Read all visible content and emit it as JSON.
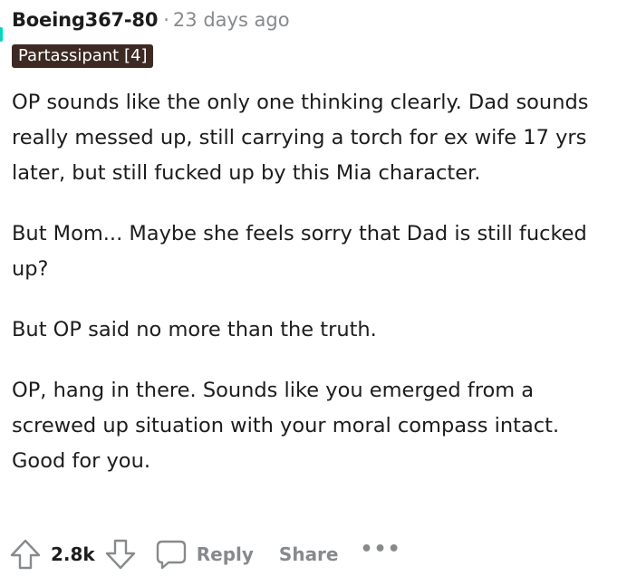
{
  "comment": {
    "author": "Boeing367-80",
    "separator": "·",
    "timestamp": "23 days ago",
    "flair": "Partassipant [4]",
    "paragraphs": [
      "OP sounds like the only one thinking clearly. Dad sounds really messed up, still carrying a torch for ex wife 17 yrs later, but still fucked up by this Mia character.",
      "But Mom... Maybe she feels sorry that Dad is still fucked up?",
      "But OP said no more than the truth.",
      "OP, hang in there. Sounds like you emerged from a screwed up situation with your moral compass intact. Good for you."
    ]
  },
  "actions": {
    "upvote_icon": "upvote-arrow-icon",
    "score": "2.8k",
    "downvote_icon": "downvote-arrow-icon",
    "reply_icon": "speech-bubble-icon",
    "reply_label": "Reply",
    "share_label": "Share",
    "more_label": "•••"
  },
  "colors": {
    "text": "#1c1c1c",
    "muted": "#878a8c",
    "flair_bg": "#3d2a23",
    "thread_accent": "#0dd3bb"
  }
}
